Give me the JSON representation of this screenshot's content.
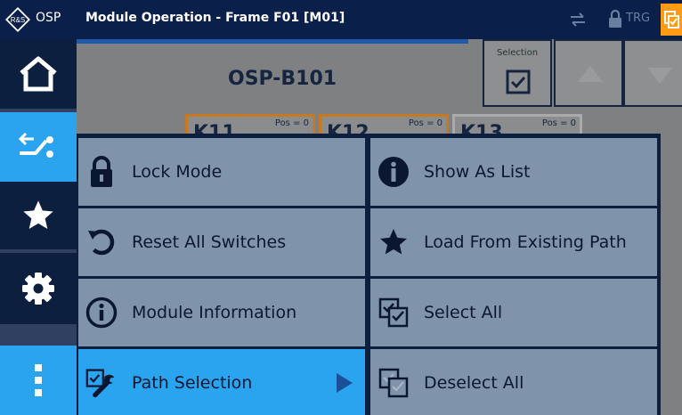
{
  "titlebar": {
    "logo_icon": "rs-diamond-logo-icon",
    "app_name": "OSP",
    "title": "Module Operation - Frame F01 [M01]",
    "trigger_label": "TRG"
  },
  "nav": {
    "items": [
      {
        "icon": "home-icon"
      },
      {
        "icon": "path-switch-icon",
        "active": true
      },
      {
        "icon": "star-icon"
      },
      {
        "icon": "gear-icon"
      },
      {
        "icon": "more-vertical-icon",
        "active": true
      }
    ]
  },
  "module": {
    "title": "OSP-B101",
    "selection_label": "Selection",
    "switches": [
      {
        "name": "K11",
        "pos": "Pos = 0"
      },
      {
        "name": "K12",
        "pos": "Pos = 0"
      },
      {
        "name": "K13",
        "pos": "Pos = 0"
      }
    ]
  },
  "menu": {
    "lock_mode": "Lock Mode",
    "reset_all": "Reset All Switches",
    "module_info": "Module Information",
    "path_selection": "Path Selection",
    "show_as_list": "Show As List",
    "load_path": "Load From Existing Path",
    "select_all": "Select All",
    "deselect_all": "Deselect All"
  },
  "colors": {
    "titlebar": "#0a1f4a",
    "menu_item": "#7f94ab",
    "active": "#2aa4ee",
    "accent_orange": "#ff9a14"
  }
}
